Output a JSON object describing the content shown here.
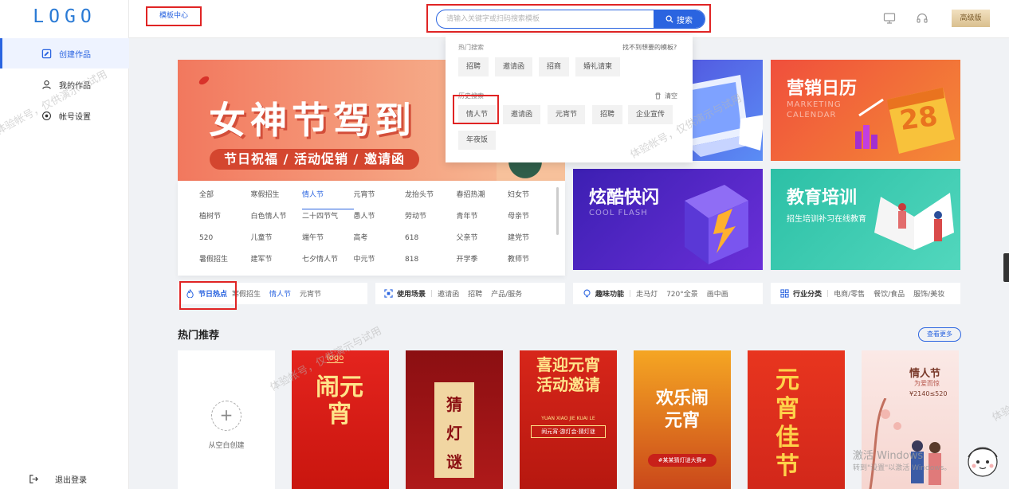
{
  "sidebar": {
    "logo": "LOGO",
    "items": [
      {
        "label": "创建作品",
        "icon": "edit-icon",
        "active": true
      },
      {
        "label": "我的作品",
        "icon": "user-icon",
        "active": false
      },
      {
        "label": "帐号设置",
        "icon": "settings-icon",
        "active": false
      }
    ],
    "logout": "退出登录"
  },
  "header": {
    "template_center": "模板中心",
    "search": {
      "placeholder": "请输入关键字或扫码搜索模板",
      "button": "搜索"
    },
    "icons": [
      "monitor-icon",
      "headset-icon"
    ],
    "pro_badge": "高级版"
  },
  "dropdown": {
    "hot_title": "热门搜索",
    "not_found_link": "找不到想要的模板?",
    "hot_tags": [
      "招聘",
      "邀请函",
      "招商",
      "婚礼请柬"
    ],
    "history_title": "历史搜索",
    "clear": "清空",
    "history_tags": [
      "情人节",
      "邀请函",
      "元宵节",
      "招聘",
      "企业宣传",
      "年夜饭"
    ]
  },
  "banner": {
    "title": "女神节驾到",
    "subtitle": "节日祝福 / 活动促销 / 邀请函"
  },
  "tiles": {
    "market": {
      "title": "营销日历",
      "en": "MARKETING CALENDAR",
      "date": "28"
    },
    "cool": {
      "title": "炫酷快闪",
      "en": "COOL FLASH"
    },
    "edu": {
      "title": "教育培训",
      "subtitle": "招生培训补习在线教育"
    }
  },
  "festivals": {
    "items": [
      "全部",
      "寒假招生",
      "情人节",
      "元宵节",
      "龙抬头节",
      "春招热潮",
      "妇女节",
      "植树节",
      "白色情人节",
      "二十四节气",
      "愚人节",
      "劳动节",
      "青年节",
      "母亲节",
      "520",
      "儿童节",
      "端午节",
      "高考",
      "618",
      "父亲节",
      "建党节",
      "暑假招生",
      "建军节",
      "七夕情人节",
      "中元节",
      "818",
      "开学季",
      "教师节"
    ],
    "highlighted": "情人节"
  },
  "categories": [
    {
      "lead": "节日热点",
      "icon": "fire-icon",
      "items": [
        "寒假招生",
        "情人节",
        "元宵节"
      ],
      "highlight": "情人节"
    },
    {
      "lead": "使用场景",
      "icon": "scan-icon",
      "items": [
        "邀请函",
        "招聘",
        "产品/服务"
      ]
    },
    {
      "lead": "趣味功能",
      "icon": "bulb-icon",
      "items": [
        "走马灯",
        "720°全景",
        "画中画"
      ]
    },
    {
      "lead": "行业分类",
      "icon": "grid-icon",
      "items": [
        "电商/零售",
        "餐饮/食品",
        "服饰/美妆"
      ]
    }
  ],
  "hot": {
    "title": "热门推荐",
    "more": "查看更多",
    "blank_label": "从空白创建",
    "posters": [
      {
        "title": "闹元宵",
        "logo": "logo"
      },
      {
        "title": "猜灯谜"
      },
      {
        "title": "喜迎元宵 活动邀请",
        "en": "YUAN XIAO JIE KUAI LE",
        "note": "闹元宵·游灯会·猜灯谜"
      },
      {
        "title": "欢乐闹元宵",
        "note": "#某某猜灯谜大赛#"
      },
      {
        "title": "元宵佳节"
      },
      {
        "title": "情人节",
        "sub": "为爱而惊",
        "price": "¥2140≤520"
      }
    ]
  },
  "watermark": "体验帐号，仅供演示与试用",
  "windows": {
    "line1": "激活 Windows",
    "line2": "转到\"设置\"以激活 Windows。"
  },
  "colors": {
    "accent": "#2a64e0",
    "highlight_box": "#e02424",
    "banner": "#f2785e"
  }
}
